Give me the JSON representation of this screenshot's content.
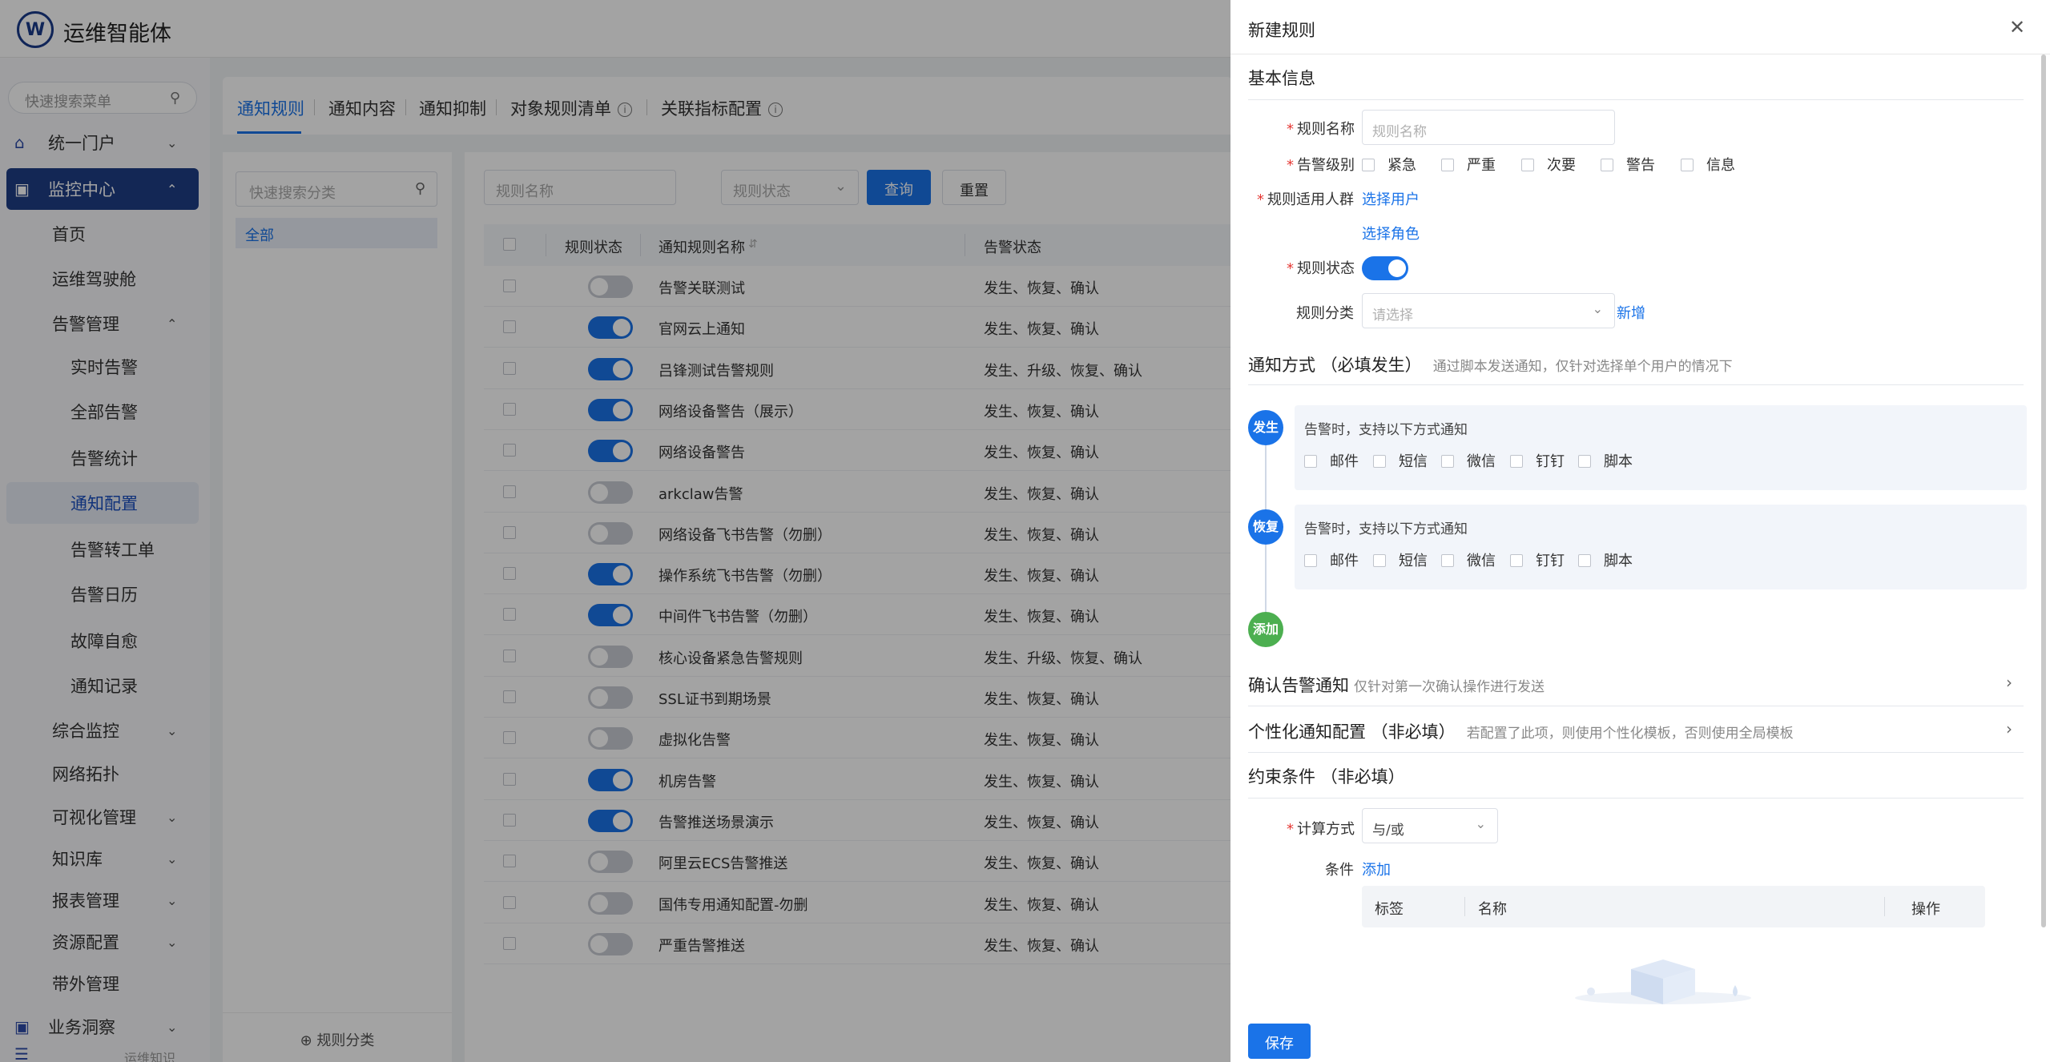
{
  "app": {
    "title": "运维智能体",
    "logo": "W"
  },
  "sidebar": {
    "search_placeholder": "快速搜索菜单",
    "items": [
      {
        "label": "统一门户",
        "icon": "home-icon"
      },
      {
        "label": "监控中心",
        "icon": "monitor-icon"
      },
      {
        "label": "首页"
      },
      {
        "label": "运维驾驶舱"
      },
      {
        "label": "告警管理"
      },
      {
        "label": "实时告警"
      },
      {
        "label": "全部告警"
      },
      {
        "label": "告警统计"
      },
      {
        "label": "通知配置"
      },
      {
        "label": "告警转工单"
      },
      {
        "label": "告警日历"
      },
      {
        "label": "故障自愈"
      },
      {
        "label": "通知记录"
      },
      {
        "label": "综合监控"
      },
      {
        "label": "网络拓扑"
      },
      {
        "label": "可视化管理"
      },
      {
        "label": "知识库"
      },
      {
        "label": "报表管理"
      },
      {
        "label": "资源配置"
      },
      {
        "label": "带外管理"
      },
      {
        "label": "业务洞察",
        "icon": "business-icon"
      }
    ],
    "footer_text": "运维知识"
  },
  "tabs": [
    "通知规则",
    "通知内容",
    "通知抑制",
    "对象规则清单",
    "关联指标配置"
  ],
  "category": {
    "search_placeholder": "快速搜索分类",
    "all_label": "全部",
    "footer_label": "规则分类"
  },
  "filters": {
    "name_placeholder": "规则名称",
    "status_placeholder": "规则状态",
    "query_label": "查询",
    "reset_label": "重置"
  },
  "table": {
    "headers": {
      "status": "规则状态",
      "name": "通知规则名称",
      "alert_status": "告警状态"
    },
    "rows": [
      {
        "on": false,
        "name": "告警关联测试",
        "status": "发生、恢复、确认"
      },
      {
        "on": true,
        "name": "官网云上通知",
        "status": "发生、恢复、确认"
      },
      {
        "on": true,
        "name": "吕锋测试告警规则",
        "status": "发生、升级、恢复、确认"
      },
      {
        "on": true,
        "name": "网络设备警告（展示）",
        "status": "发生、恢复、确认"
      },
      {
        "on": true,
        "name": "网络设备警告",
        "status": "发生、恢复、确认"
      },
      {
        "on": false,
        "name": "arkclaw告警",
        "status": "发生、恢复、确认"
      },
      {
        "on": false,
        "name": "网络设备飞书告警（勿删）",
        "status": "发生、恢复、确认"
      },
      {
        "on": true,
        "name": "操作系统飞书告警（勿删）",
        "status": "发生、恢复、确认"
      },
      {
        "on": true,
        "name": "中间件飞书告警（勿删）",
        "status": "发生、恢复、确认"
      },
      {
        "on": false,
        "name": "核心设备紧急告警规则",
        "status": "发生、升级、恢复、确认"
      },
      {
        "on": false,
        "name": "SSL证书到期场景",
        "status": "发生、恢复、确认"
      },
      {
        "on": false,
        "name": "虚拟化告警",
        "status": "发生、恢复、确认"
      },
      {
        "on": true,
        "name": "机房告警",
        "status": "发生、恢复、确认"
      },
      {
        "on": true,
        "name": "告警推送场景演示",
        "status": "发生、恢复、确认"
      },
      {
        "on": false,
        "name": "阿里云ECS告警推送",
        "status": "发生、恢复、确认"
      },
      {
        "on": false,
        "name": "国伟专用通知配置-勿删",
        "status": "发生、恢复、确认"
      },
      {
        "on": false,
        "name": "严重告警推送",
        "status": "发生、恢复、确认"
      }
    ]
  },
  "drawer": {
    "title": "新建规则",
    "basic": {
      "section_title": "基本信息",
      "rule_name_label": "规则名称",
      "rule_name_placeholder": "规则名称",
      "level_label": "告警级别",
      "levels": [
        "紧急",
        "严重",
        "次要",
        "警告",
        "信息"
      ],
      "audience_label": "规则适用人群",
      "select_user": "选择用户",
      "select_role": "选择角色",
      "status_label": "规则状态",
      "status_on": true,
      "category_label": "规则分类",
      "category_placeholder": "请选择",
      "add_category": "新增"
    },
    "notify": {
      "section_title": "通知方式 （必填发生）",
      "hint": "通过脚本发送通知，仅针对选择单个用户的情况下",
      "events": [
        {
          "dot": "发生",
          "text": "告警时，支持以下方式通知"
        },
        {
          "dot": "恢复",
          "text": "告警时，支持以下方式通知"
        }
      ],
      "methods": [
        "邮件",
        "短信",
        "微信",
        "钉钉",
        "脚本"
      ],
      "add_dot": "添加"
    },
    "confirm": {
      "title": "确认告警通知",
      "hint": "仅针对第一次确认操作进行发送"
    },
    "personal": {
      "title": "个性化通知配置 （非必填）",
      "hint": "若配置了此项，则使用个性化模板，否则使用全局模板"
    },
    "constraint": {
      "section_title": "约束条件 （非必填）",
      "calc_label": "计算方式",
      "calc_value": "与/或",
      "cond_label": "条件",
      "cond_add": "添加",
      "table_headers": [
        "标签",
        "名称",
        "操作"
      ]
    },
    "save_label": "保存"
  },
  "colors": {
    "primary": "#1a73e8",
    "nav_active": "#1f3e86",
    "dot_occur": "#1a73e8",
    "dot_add": "#4caf50",
    "required": "#e53935"
  }
}
